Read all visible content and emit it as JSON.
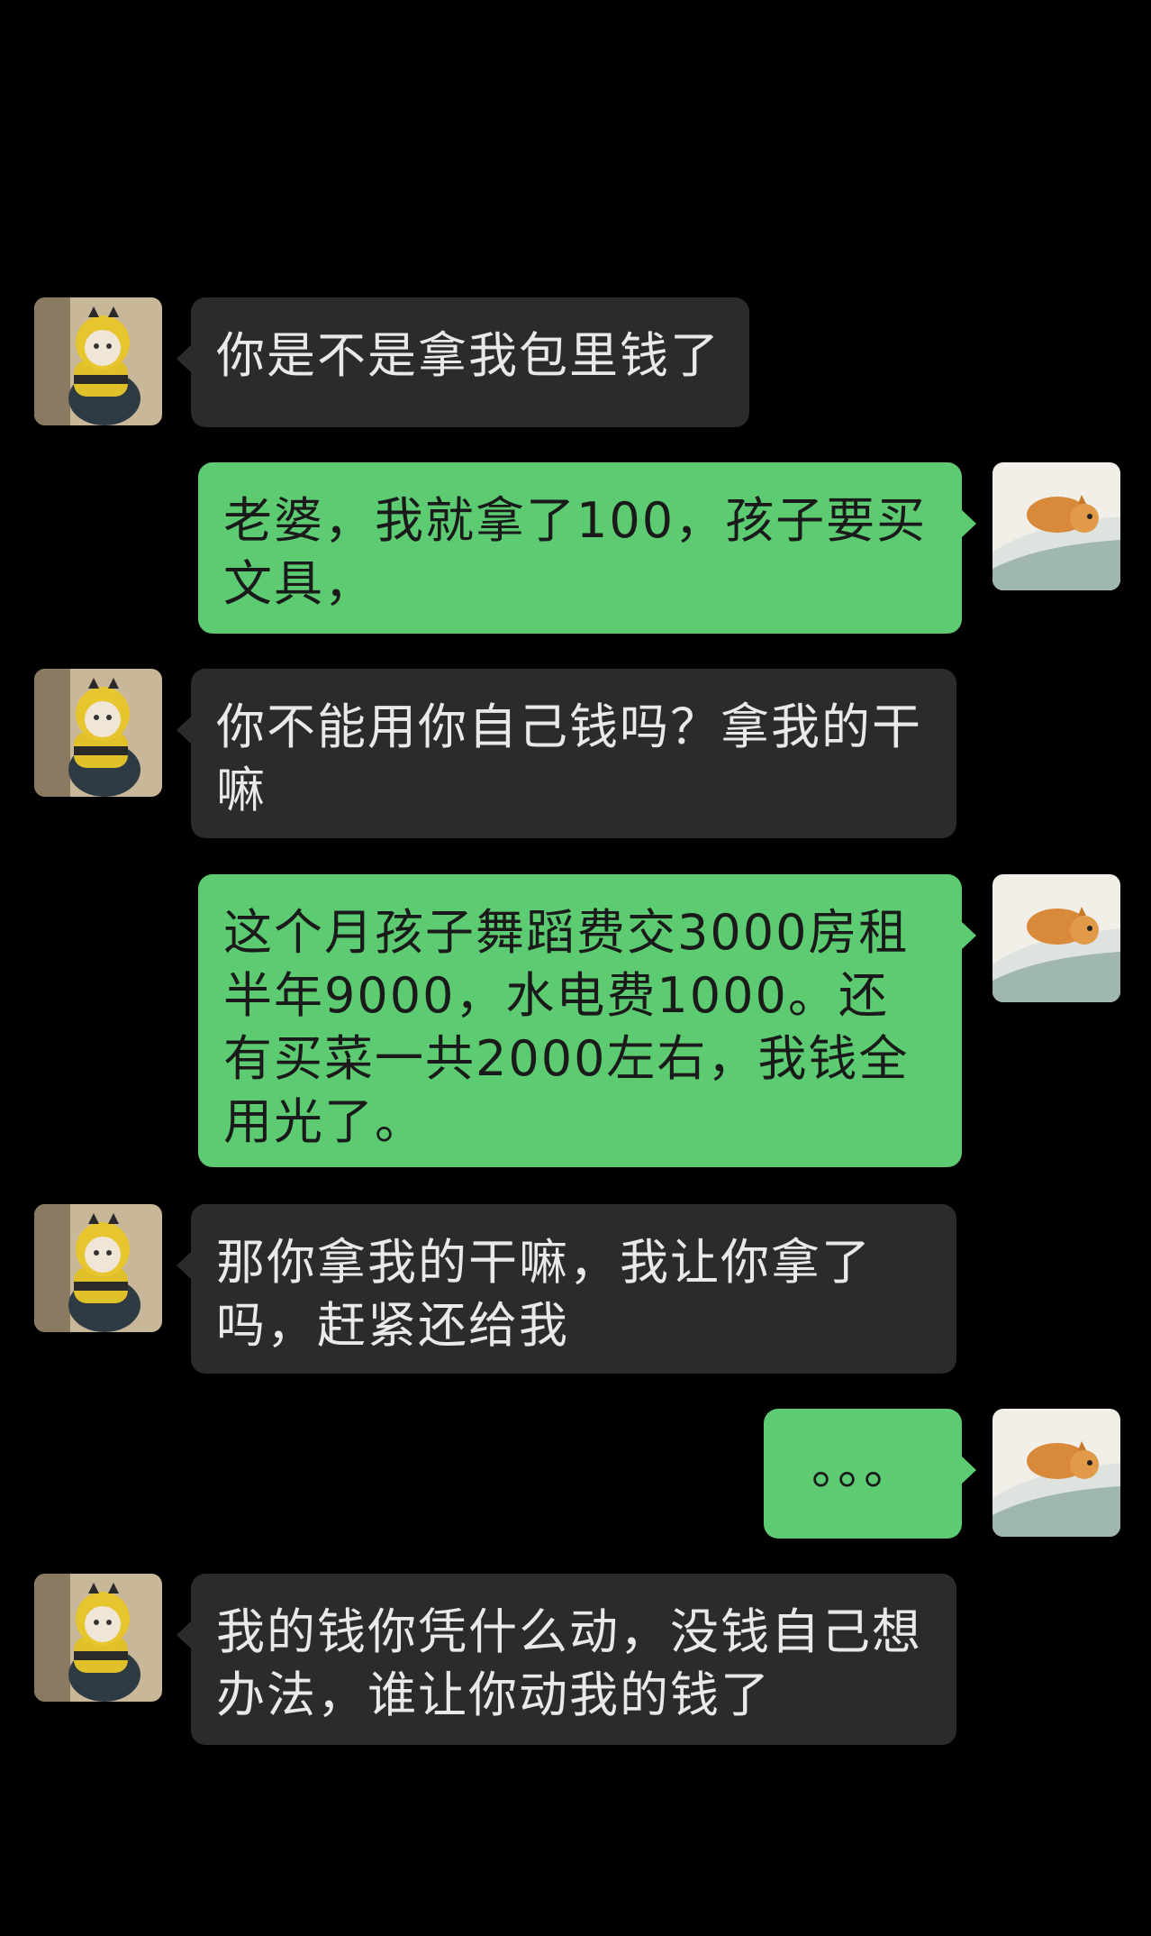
{
  "messages": [
    {
      "side": "in",
      "text": "你是不是拿我包里钱了",
      "avatar": "cat-in-bee-costume"
    },
    {
      "side": "out",
      "text": "老婆，我就拿了100，孩子要买文具，",
      "avatar": "shiba-dog-in-bathtub"
    },
    {
      "side": "in",
      "text": "你不能用你自己钱吗？拿我的干嘛",
      "avatar": "cat-in-bee-costume"
    },
    {
      "side": "out",
      "text": "这个月孩子舞蹈费交3000房租半年9000，水电费1000。还有买菜一共2000左右，我钱全用光了。",
      "avatar": "shiba-dog-in-bathtub"
    },
    {
      "side": "in",
      "text": "那你拿我的干嘛，我让你拿了吗，赶紧还给我",
      "avatar": "cat-in-bee-costume"
    },
    {
      "side": "out",
      "text": "。。。",
      "avatar": "shiba-dog-in-bathtub"
    },
    {
      "side": "in",
      "text": "我的钱你凭什么动，没钱自己想办法，谁让你动我的钱了",
      "avatar": "cat-in-bee-costume"
    }
  ],
  "colors": {
    "background": "#000000",
    "incoming_bubble": "#2b2b2b",
    "outgoing_bubble": "#5ccb72"
  }
}
